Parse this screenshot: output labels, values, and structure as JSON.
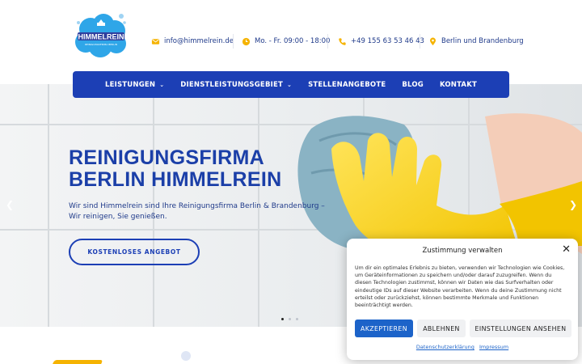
{
  "header": {
    "logo": {
      "name": "HIMMELREIN",
      "tagline": "REINIGUNGSFIRMA BERLIN"
    },
    "contacts": [
      {
        "icon": "email-icon",
        "text": "info@himmelrein.de"
      },
      {
        "icon": "clock-icon",
        "text": "Mo. - Fr. 09:00 - 18:00"
      },
      {
        "icon": "phone-icon",
        "text": "+49 155 63 53 46 43"
      },
      {
        "icon": "location-pin-icon",
        "text": "Berlin und Brandenburg"
      }
    ],
    "icon_color": "#f5b301"
  },
  "nav": {
    "items": [
      {
        "label": "LEISTUNGEN",
        "dropdown": true
      },
      {
        "label": "DIENSTLEISTUNGSGEBIET",
        "dropdown": true
      },
      {
        "label": "STELLENANGEBOTE",
        "dropdown": false
      },
      {
        "label": "BLOG",
        "dropdown": false
      },
      {
        "label": "KONTAKT",
        "dropdown": false
      }
    ]
  },
  "hero": {
    "title_line1": "REINIGUNGSFIRMA",
    "title_line2": "BERLIN HIMMELREIN",
    "subtitle": "Wir sind Himmelrein sind Ihre Reinigungsfirma Berlin & Brandenburg – Wir reinigen, Sie genießen.",
    "cta": "KOSTENLOSES ANGEBOT",
    "prev_icon": "chevron-left-icon",
    "next_icon": "chevron-right-icon",
    "slides_count": 3,
    "active_slide": 1
  },
  "consent": {
    "title": "Zustimmung verwalten",
    "text": "Um dir ein optimales Erlebnis zu bieten, verwenden wir Technologien wie Cookies, um Geräteinformationen zu speichern und/oder darauf zuzugreifen. Wenn du diesen Technologien zustimmst, können wir Daten wie das Surfverhalten oder eindeutige IDs auf dieser Website verarbeiten. Wenn du deine Zustimmung nicht erteilst oder zurückziehst, können bestimmte Merkmale und Funktionen beeinträchtigt werden.",
    "accept": "AKZEPTIEREN",
    "deny": "ABLEHNEN",
    "settings": "EINSTELLUNGEN ANSEHEN",
    "link_privacy": "Datenschutzerklärung",
    "link_imprint": "Impressum"
  },
  "colors": {
    "brand_blue": "#1c3fb5",
    "accent_yellow": "#f5b301",
    "button_blue": "#1c63c9"
  }
}
